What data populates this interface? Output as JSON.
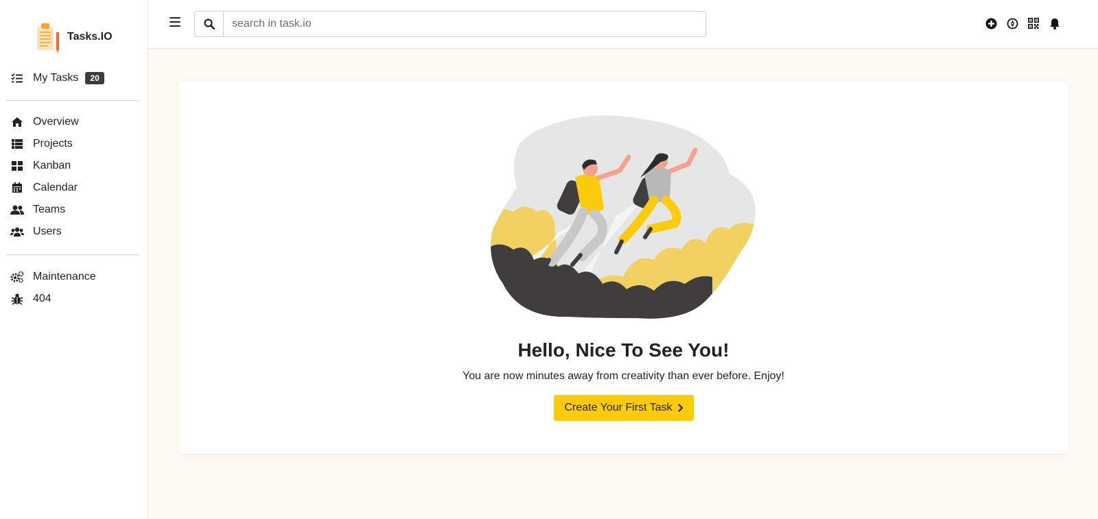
{
  "brand": {
    "name": "Tasks.IO",
    "logo_icon": "clipboard-pencil-logo",
    "accent": "#f7a431"
  },
  "sidebar": {
    "my_tasks": {
      "label": "My Tasks",
      "count": "20",
      "icon": "checklist-icon"
    },
    "nav": [
      {
        "label": "Overview",
        "icon": "home-icon"
      },
      {
        "label": "Projects",
        "icon": "list-icon"
      },
      {
        "label": "Kanban",
        "icon": "grid-icon"
      },
      {
        "label": "Calendar",
        "icon": "calendar-icon"
      },
      {
        "label": "Teams",
        "icon": "users-icon"
      },
      {
        "label": "Users",
        "icon": "group-icon"
      }
    ],
    "extra": [
      {
        "label": "Maintenance",
        "icon": "gears-icon"
      },
      {
        "label": "404",
        "icon": "bug-icon"
      }
    ]
  },
  "header": {
    "search": {
      "placeholder": "search in task.io",
      "value": ""
    },
    "icons": [
      "plus-circle-icon",
      "compass-icon",
      "qrcode-icon",
      "bell-icon"
    ]
  },
  "main": {
    "title": "Hello, Nice To See You!",
    "subtitle": "You are now minutes away from creativity than ever before. Enjoy!",
    "cta_label": "Create Your First Task"
  },
  "colors": {
    "accent": "#fccb0b",
    "background": "#fcf9f2",
    "dark": "#3d3d3d"
  }
}
